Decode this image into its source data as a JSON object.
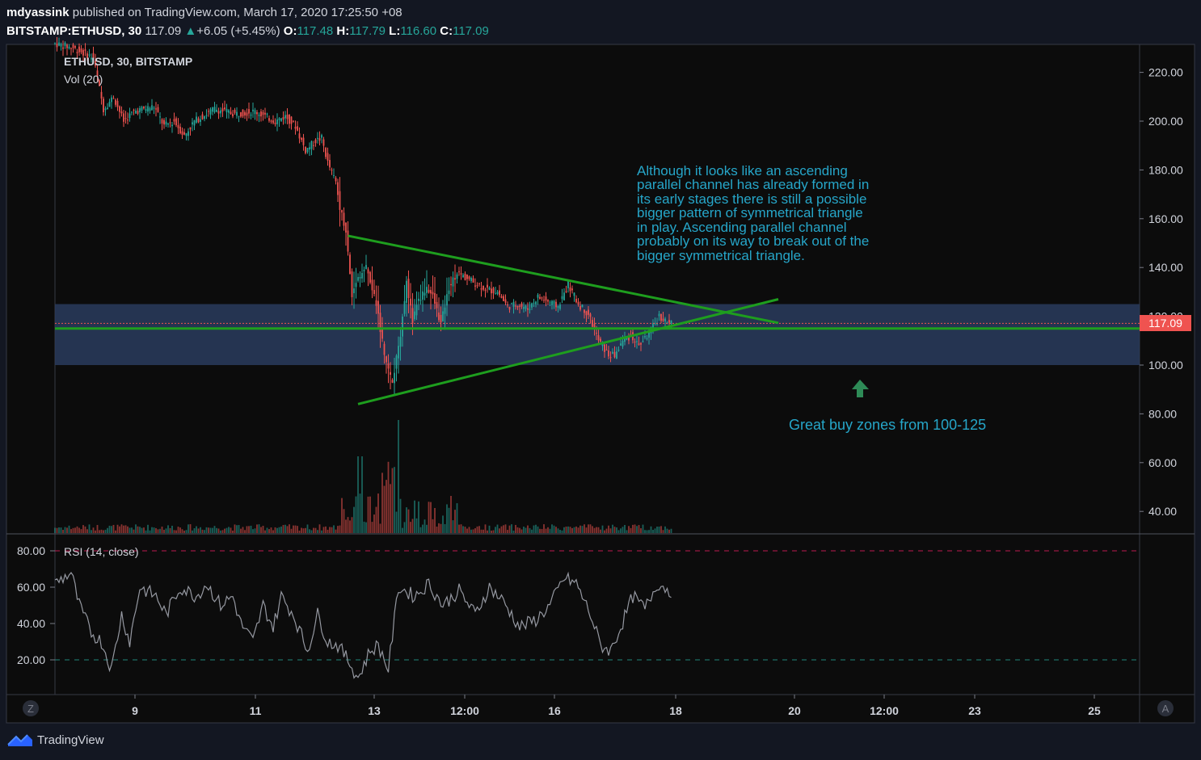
{
  "header": {
    "author": "mdyassink",
    "published_text": "published on TradingView.com, March 17, 2020 17:25:50 +08",
    "symbol": "BITSTAMP:ETHUSD, 30",
    "last": "117.09",
    "change": "+6.05 (+5.45%)",
    "open_label": "O:",
    "open": "117.48",
    "high_label": "H:",
    "high": "117.79",
    "low_label": "L:",
    "low": "116.60",
    "close_label": "C:",
    "close": "117.09"
  },
  "legend": {
    "series_title": "ETHUSD, 30, BITSTAMP",
    "volume_title": "Vol (20)",
    "rsi_title": "RSI (14, close)"
  },
  "annotations": {
    "note_lines": [
      "Although it looks like an ascending",
      "parallel channel has already formed in",
      "its early stages there is still a possible",
      "bigger pattern of symmetrical triangle",
      "in play. Ascending parallel channel",
      "probably on its way to break out of the",
      "bigger symmetrical triangle."
    ],
    "buy_zone_text": "Great buy zones from 100-125"
  },
  "price_axis": {
    "ticks": [
      "220.00",
      "200.00",
      "180.00",
      "160.00",
      "140.00",
      "120.00",
      "100.00",
      "80.00",
      "60.00",
      "40.00"
    ],
    "last_price_label": "117.09"
  },
  "rsi_axis": {
    "ticks": [
      "80.00",
      "60.00",
      "40.00",
      "20.00"
    ]
  },
  "time_axis": {
    "ticks": [
      "9",
      "11",
      "13",
      "12:00",
      "16",
      "18",
      "20",
      "12:00",
      "23",
      "25"
    ]
  },
  "controls": {
    "zoom_left": "Z",
    "auto_right": "A"
  },
  "footer": {
    "brand": "TradingView"
  },
  "colors": {
    "background": "#131722",
    "up": "#26a69a",
    "down": "#ef5350",
    "triangle": "#1e9e1e",
    "zone": "#2a3c5e",
    "annotation": "#26a6c9",
    "rsi_line": "#9598a1"
  },
  "chart_data": {
    "type": "candlestick",
    "price_ylim": [
      30,
      230
    ],
    "rsi_ylim": [
      0,
      100
    ],
    "buy_zone": [
      100,
      125
    ],
    "price_path": [
      [
        0,
        232
      ],
      [
        10,
        230
      ],
      [
        20,
        226
      ],
      [
        25,
        205
      ],
      [
        30,
        210
      ],
      [
        35,
        200
      ],
      [
        40,
        204
      ],
      [
        50,
        206
      ],
      [
        55,
        198
      ],
      [
        60,
        200
      ],
      [
        65,
        194
      ],
      [
        70,
        200
      ],
      [
        80,
        205
      ],
      [
        90,
        203
      ],
      [
        100,
        204
      ],
      [
        110,
        200
      ],
      [
        115,
        202
      ],
      [
        120,
        198
      ],
      [
        125,
        188
      ],
      [
        130,
        192
      ],
      [
        133,
        193
      ],
      [
        136,
        183
      ],
      [
        140,
        175
      ],
      [
        142,
        165
      ],
      [
        145,
        155
      ],
      [
        148,
        128
      ],
      [
        150,
        135
      ],
      [
        155,
        140
      ],
      [
        160,
        125
      ],
      [
        165,
        100
      ],
      [
        168,
        92
      ],
      [
        172,
        113
      ],
      [
        175,
        134
      ],
      [
        178,
        118
      ],
      [
        180,
        125
      ],
      [
        185,
        132
      ],
      [
        188,
        128
      ],
      [
        192,
        117
      ],
      [
        196,
        132
      ],
      [
        200,
        138
      ],
      [
        204,
        136
      ],
      [
        208,
        134
      ],
      [
        215,
        131
      ],
      [
        220,
        130
      ],
      [
        225,
        124
      ],
      [
        230,
        125
      ],
      [
        235,
        123
      ],
      [
        240,
        128
      ],
      [
        245,
        126
      ],
      [
        250,
        124
      ],
      [
        255,
        133
      ],
      [
        260,
        125
      ],
      [
        265,
        121
      ],
      [
        270,
        110
      ],
      [
        275,
        104
      ],
      [
        278,
        104
      ],
      [
        282,
        110
      ],
      [
        286,
        112
      ],
      [
        290,
        108
      ],
      [
        295,
        113
      ],
      [
        300,
        120
      ],
      [
        305,
        117
      ]
    ],
    "rsi_path": [
      [
        0,
        62
      ],
      [
        8,
        68
      ],
      [
        12,
        50
      ],
      [
        18,
        35
      ],
      [
        23,
        30
      ],
      [
        28,
        15
      ],
      [
        33,
        45
      ],
      [
        37,
        30
      ],
      [
        42,
        60
      ],
      [
        50,
        55
      ],
      [
        55,
        45
      ],
      [
        62,
        60
      ],
      [
        70,
        55
      ],
      [
        75,
        62
      ],
      [
        82,
        50
      ],
      [
        88,
        55
      ],
      [
        92,
        40
      ],
      [
        98,
        30
      ],
      [
        103,
        50
      ],
      [
        108,
        38
      ],
      [
        112,
        55
      ],
      [
        118,
        45
      ],
      [
        125,
        25
      ],
      [
        130,
        45
      ],
      [
        135,
        30
      ],
      [
        140,
        28
      ],
      [
        145,
        20
      ],
      [
        150,
        10
      ],
      [
        156,
        25
      ],
      [
        160,
        28
      ],
      [
        165,
        15
      ],
      [
        170,
        60
      ],
      [
        178,
        55
      ],
      [
        185,
        62
      ],
      [
        192,
        50
      ],
      [
        200,
        58
      ],
      [
        208,
        45
      ],
      [
        215,
        60
      ],
      [
        222,
        52
      ],
      [
        230,
        38
      ],
      [
        238,
        42
      ],
      [
        245,
        50
      ],
      [
        252,
        65
      ],
      [
        258,
        62
      ],
      [
        265,
        45
      ],
      [
        270,
        28
      ],
      [
        275,
        25
      ],
      [
        280,
        38
      ],
      [
        286,
        55
      ],
      [
        292,
        48
      ],
      [
        298,
        62
      ],
      [
        305,
        58
      ]
    ],
    "triangle": {
      "upper": [
        [
          145,
          153
        ],
        [
          300,
          127
        ]
      ],
      "lower": [
        [
          150,
          84
        ],
        [
          300,
          115
        ]
      ],
      "horizontal": [
        [
          0,
          115
        ],
        [
          450,
          115
        ]
      ]
    }
  }
}
